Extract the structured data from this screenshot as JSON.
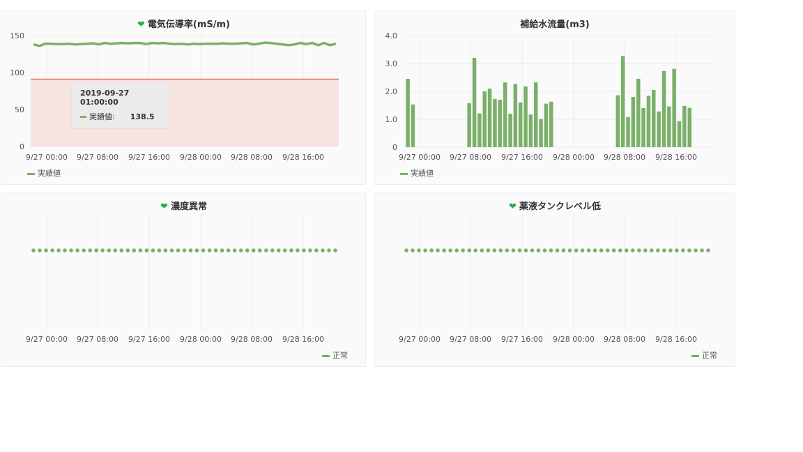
{
  "colors": {
    "series": "#7ab06a",
    "threshold_line": "#e26f5a",
    "threshold_fill": "#f8e3e3",
    "heart": "#2dab4f",
    "grid": "#ececec"
  },
  "x_ticks": [
    "9/27 00:00",
    "9/27 08:00",
    "9/27 16:00",
    "9/28 00:00",
    "9/28 08:00",
    "9/28 16:00"
  ],
  "panels": {
    "conductivity": {
      "title": "電気伝導率(mS/m)",
      "icon": "heart-icon",
      "legend": "実績値",
      "tooltip": {
        "time": "2019-09-27 01:00:00",
        "label": "実績値:",
        "value": "138.5"
      }
    },
    "flow": {
      "title": "補給水流量(m3)",
      "legend": "実績値"
    },
    "concentration": {
      "title": "濃度異常",
      "icon": "heart-icon",
      "legend": "正常"
    },
    "tank": {
      "title": "薬液タンクレベル低",
      "icon": "heart-icon",
      "legend": "正常"
    }
  },
  "chart_data": [
    {
      "type": "line",
      "title": "電気伝導率(mS/m)",
      "x_range_hours": [
        0,
        46
      ],
      "ylim": [
        0,
        150
      ],
      "yticks": [
        0,
        50,
        100,
        150
      ],
      "threshold": 91,
      "series": [
        {
          "name": "実績値",
          "values": [
            138,
            136,
            139,
            139,
            138.5,
            138.5,
            139,
            138,
            138.5,
            139,
            139.5,
            138,
            140,
            139,
            139.5,
            140,
            139.5,
            140,
            140,
            138.5,
            140,
            139.5,
            140,
            139,
            138.5,
            139,
            138,
            139,
            138.5,
            139,
            139,
            139,
            139.5,
            139,
            139,
            139.5,
            140,
            138,
            139,
            140.5,
            140,
            139,
            138,
            137,
            138,
            140,
            138.5,
            140,
            137,
            140,
            137,
            139
          ]
        }
      ]
    },
    {
      "type": "bar",
      "title": "補給水流量(m3)",
      "ylim": [
        0,
        4
      ],
      "yticks": [
        "0",
        "1.0",
        "2.0",
        "3.0",
        "4.0"
      ],
      "series": [
        {
          "name": "実績値",
          "values": [
            2.45,
            1.53,
            0,
            0,
            0,
            0,
            0,
            0,
            0,
            0,
            0,
            0,
            1.58,
            3.2,
            1.21,
            2.0,
            2.1,
            1.73,
            1.7,
            2.32,
            1.2,
            2.27,
            1.6,
            2.18,
            1.17,
            2.32,
            1.01,
            1.56,
            1.63,
            0,
            0,
            0,
            0,
            0,
            0,
            0,
            0,
            0,
            0,
            0,
            0,
            1.86,
            3.27,
            1.08,
            1.8,
            2.45,
            1.4,
            1.84,
            2.05,
            1.28,
            2.73,
            1.46,
            2.81,
            0.93,
            1.48,
            1.41
          ]
        }
      ]
    },
    {
      "type": "scatter",
      "title": "濃度異常",
      "series": [
        {
          "name": "正常",
          "count": 49
        }
      ]
    },
    {
      "type": "scatter",
      "title": "薬液タンクレベル低",
      "series": [
        {
          "name": "正常",
          "count": 49
        }
      ]
    }
  ]
}
